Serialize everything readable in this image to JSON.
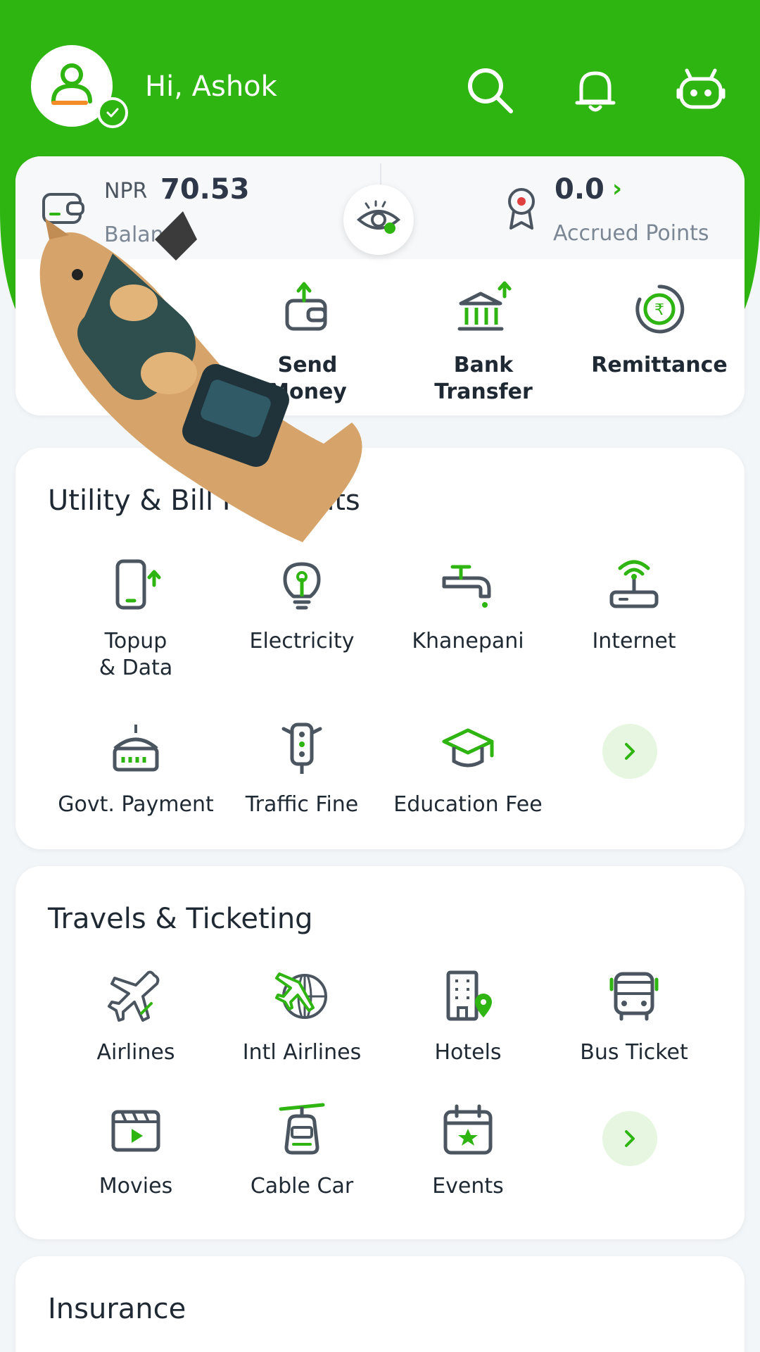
{
  "header": {
    "greeting": "Hi, Ashok",
    "brand_color": "#2fb511",
    "icons": [
      "search-icon",
      "bell-icon",
      "chatbot-icon"
    ]
  },
  "balance": {
    "currency": "NPR",
    "amount": "70.53",
    "label": "Balance",
    "points_value": "0.0",
    "points_label": "Accrued Points"
  },
  "quick_actions": [
    {
      "label": "Send\nMoney",
      "icon": "wallet-send-icon"
    },
    {
      "label": "Bank\nTransfer",
      "icon": "bank-transfer-icon"
    },
    {
      "label": "Remittance",
      "icon": "remittance-icon"
    }
  ],
  "utility": {
    "title": "Utility & Bill Payments",
    "items": [
      {
        "label": "Topup\n& Data",
        "icon": "mobile-topup-icon"
      },
      {
        "label": "Electricity",
        "icon": "bulb-icon"
      },
      {
        "label": "Khanepani",
        "icon": "water-tap-icon"
      },
      {
        "label": "Internet",
        "icon": "router-icon"
      },
      {
        "label": "Govt. Payment",
        "icon": "government-icon"
      },
      {
        "label": "Traffic Fine",
        "icon": "traffic-light-icon"
      },
      {
        "label": "Education Fee",
        "icon": "graduation-cap-icon"
      }
    ]
  },
  "travel": {
    "title": "Travels & Ticketing",
    "items": [
      {
        "label": "Airlines",
        "icon": "airplane-icon"
      },
      {
        "label": "Intl Airlines",
        "icon": "intl-airplane-icon"
      },
      {
        "label": "Hotels",
        "icon": "hotel-icon"
      },
      {
        "label": "Bus Ticket",
        "icon": "bus-icon"
      },
      {
        "label": "Movies",
        "icon": "movie-icon"
      },
      {
        "label": "Cable Car",
        "icon": "cable-car-icon"
      },
      {
        "label": "Events",
        "icon": "calendar-event-icon"
      }
    ]
  },
  "insurance": {
    "title": "Insurance"
  }
}
